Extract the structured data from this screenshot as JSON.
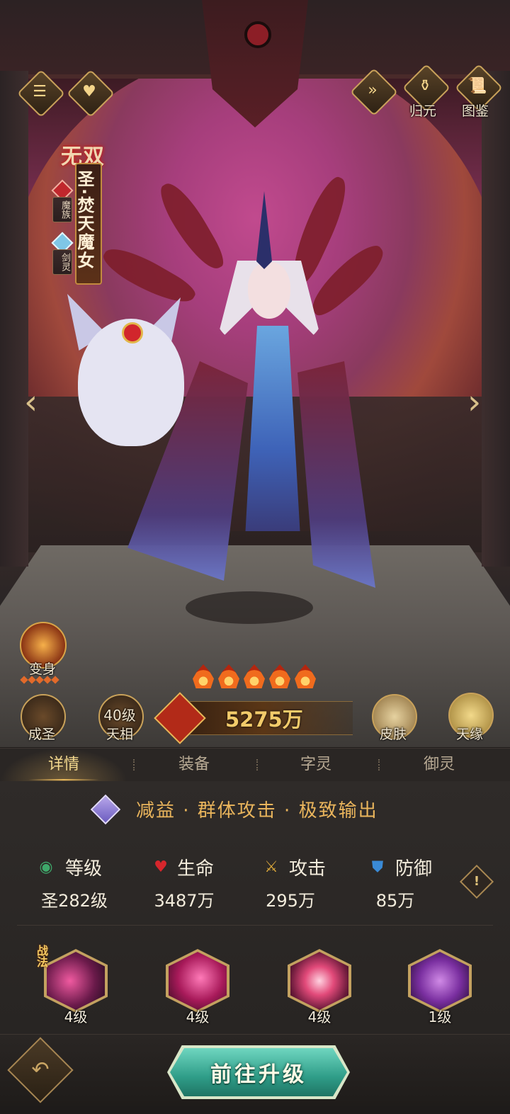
{
  "hero": {
    "title_badge": "无双",
    "name": "圣·焚天魔女",
    "tags": [
      {
        "label": "魔族",
        "gem_color": "#c0272d",
        "icon": "demon-clan-icon"
      },
      {
        "label": "剑灵",
        "gem_color": "#7fc6e6",
        "icon": "sword-spirit-icon"
      }
    ],
    "star_count": 5,
    "power": "5275万"
  },
  "top_bar": {
    "left_icons": [
      "menu-icon",
      "heart-icon"
    ],
    "right_icons": [
      {
        "label": "",
        "icon": "fast-forward-icon"
      },
      {
        "label": "归元",
        "icon": "pot-icon"
      },
      {
        "label": "图鉴",
        "icon": "scroll-icon"
      }
    ]
  },
  "actions": {
    "transform": "变身",
    "transform_dots": 5,
    "ascend": "成圣",
    "celestial_level": "40级",
    "celestial": "天相",
    "skin": "皮肤",
    "fate": "天缘"
  },
  "tabs": [
    {
      "label": "详情",
      "active": true
    },
    {
      "label": "装备",
      "active": false
    },
    {
      "label": "字灵",
      "active": false
    },
    {
      "label": "御灵",
      "active": false
    }
  ],
  "tagline": "减益 · 群体攻击 · 极致输出",
  "stats": [
    {
      "label": "等级",
      "value": "圣282级",
      "icon": "level-icon",
      "color": "#3ea86a"
    },
    {
      "label": "生命",
      "value": "3487万",
      "icon": "heart-icon",
      "color": "#d6262c"
    },
    {
      "label": "攻击",
      "value": "295万",
      "icon": "crossed-swords-icon",
      "color": "#d8a63a"
    },
    {
      "label": "防御",
      "value": "85万",
      "icon": "shield-icon",
      "color": "#3a8ad6"
    }
  ],
  "info_icon": "!",
  "skills": {
    "combat_label": "战法",
    "items": [
      {
        "level": "4级",
        "color": "#9a2f6e"
      },
      {
        "level": "4级",
        "color": "#b8236a"
      },
      {
        "level": "4级",
        "color": "#d63a6a"
      },
      {
        "level": "1级",
        "color": "#7a2fa0"
      }
    ]
  },
  "bottom": {
    "back_icon": "back-arrow-icon",
    "go_upgrade": "前往升级"
  },
  "nav": {
    "prev": "‹",
    "next": "›"
  }
}
